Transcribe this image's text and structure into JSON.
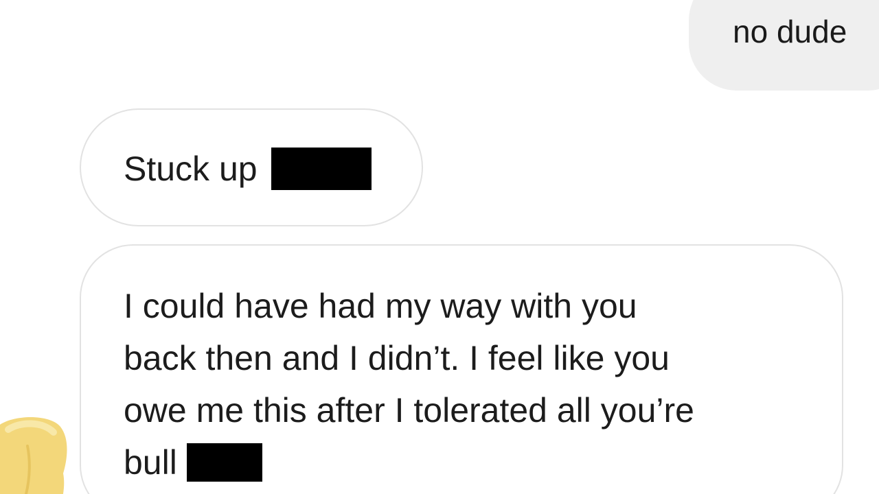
{
  "messages": {
    "sent": [
      {
        "text": "no dude"
      }
    ],
    "received": [
      {
        "text": "Stuck up"
      },
      {
        "lines": [
          "I could have had my way with you",
          "back then and I didn’t. I feel like you",
          "owe me this after I tolerated all you’re",
          "bull"
        ]
      }
    ]
  },
  "colors": {
    "sent_bubble": "#efefef",
    "received_bubble_border": "#e2e2e2",
    "redaction": "#000000",
    "sticker": "#f3d77a"
  },
  "icons": {
    "sticker": "yellow-sticker-icon"
  }
}
